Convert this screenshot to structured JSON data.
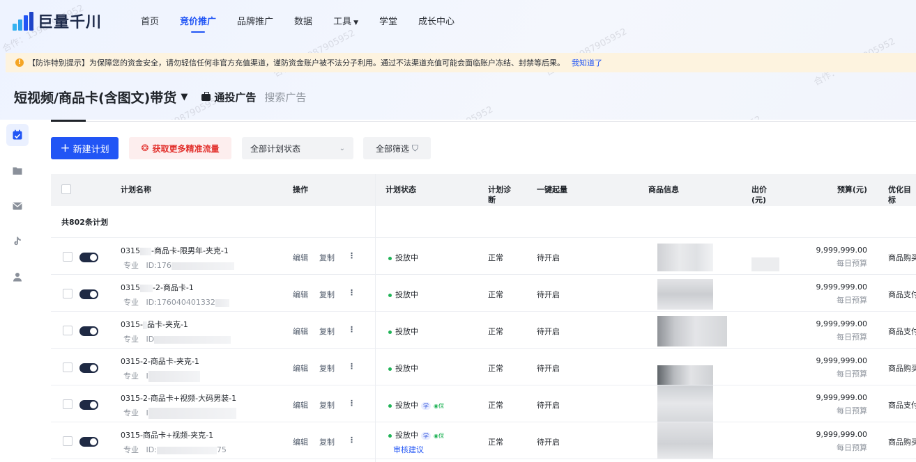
{
  "app": {
    "brand": "巨量千川",
    "brand_colors": [
      "#2155f5",
      "#36b3f0",
      "#1d2a4a"
    ]
  },
  "nav": {
    "items": [
      {
        "label": "首页"
      },
      {
        "label": "竞价推广",
        "active": true
      },
      {
        "label": "品牌推广"
      },
      {
        "label": "数据"
      },
      {
        "label": "工具",
        "has_dropdown": true
      },
      {
        "label": "学堂"
      },
      {
        "label": "成长中心"
      }
    ]
  },
  "notice": {
    "text": "【防诈特别提示】为保障您的资金安全，请勿轻信任何非官方充值渠道，谨防资金账户被不法分子利用。通过不法渠道充值可能会面临账户冻结、封禁等后果。",
    "link": "我知道了"
  },
  "page": {
    "title": "短视频/商品卡(含图文)带货",
    "tabs": [
      {
        "label": "通投广告",
        "active": true
      },
      {
        "label": "搜索广告",
        "active": false
      }
    ]
  },
  "sidebar": {
    "items": [
      {
        "icon": "calendar-icon",
        "active": true
      },
      {
        "icon": "folder-icon"
      },
      {
        "icon": "mail-icon"
      },
      {
        "icon": "douyin-icon"
      },
      {
        "icon": "user-icon"
      }
    ]
  },
  "toolbar": {
    "new_plan": "新建计划",
    "promo": "获取更多精准流量",
    "status_select": "全部计划状态",
    "filter": "全部筛选"
  },
  "table": {
    "headers": {
      "name": "计划名称",
      "ops": "操作",
      "status": "计划状态",
      "diag_1": "计划诊",
      "diag_2": "断",
      "boost": "一键起量",
      "product": "商品信息",
      "bid_1": "出价",
      "bid_2": "(元)",
      "budget": "预算(元)",
      "goal": "优化目标"
    },
    "summary": "共802条计划",
    "ops": {
      "edit": "编辑",
      "copy": "复制"
    },
    "rows": [
      {
        "name_a": "0315",
        "name_b": "-商品卡-限男年-夹克-1",
        "type": "专业",
        "id_prefix": "ID:176",
        "status": "投放中",
        "tags": false,
        "review": "",
        "diag": "正常",
        "boost": "待开启",
        "budget": "9,999,999.00",
        "budget_sub": "每日预算",
        "goal": "商品购买"
      },
      {
        "name_a": "0315",
        "name_b": "-2-商品卡-1",
        "type": "专业",
        "id_prefix": "ID:176040401332",
        "status": "投放中",
        "tags": false,
        "review": "",
        "diag": "正常",
        "boost": "待开启",
        "budget": "9,999,999.00",
        "budget_sub": "每日预算",
        "goal": "商品支付"
      },
      {
        "name_a": "0315-",
        "name_b": "品卡-夹克-1",
        "type": "专业",
        "id_prefix": "ID",
        "status": "投放中",
        "tags": false,
        "review": "",
        "diag": "正常",
        "boost": "待开启",
        "budget": "9,999,999.00",
        "budget_sub": "每日预算",
        "goal": "商品支付"
      },
      {
        "name_a": "0315-2-商品卡-夹克-1",
        "name_b": "",
        "type": "专业",
        "id_prefix": "I",
        "status": "投放中",
        "tags": false,
        "review": "",
        "diag": "正常",
        "boost": "待开启",
        "budget": "9,999,999.00",
        "budget_sub": "每日预算",
        "goal": "商品购买"
      },
      {
        "name_a": "0315-2-商品卡+视频-大码男装-1",
        "name_b": "",
        "type": "专业",
        "id_prefix": "I",
        "status": "投放中",
        "tags": true,
        "review": "",
        "diag": "正常",
        "boost": "待开启",
        "budget": "9,999,999.00",
        "budget_sub": "每日预算",
        "goal": "商品支付"
      },
      {
        "name_a": "0315-商品卡+视频-夹克-1",
        "name_b": "",
        "type": "专业",
        "id_prefix": "ID:",
        "id_suffix": "75",
        "status": "投放中",
        "tags": true,
        "review": "审核建议",
        "diag": "正常",
        "boost": "待开启",
        "budget": "9,999,999.00",
        "budget_sub": "每日预算",
        "goal": "商品购买"
      }
    ],
    "tag_xue": "学",
    "tag_bao": "保"
  },
  "watermark": "合作：15987905952"
}
